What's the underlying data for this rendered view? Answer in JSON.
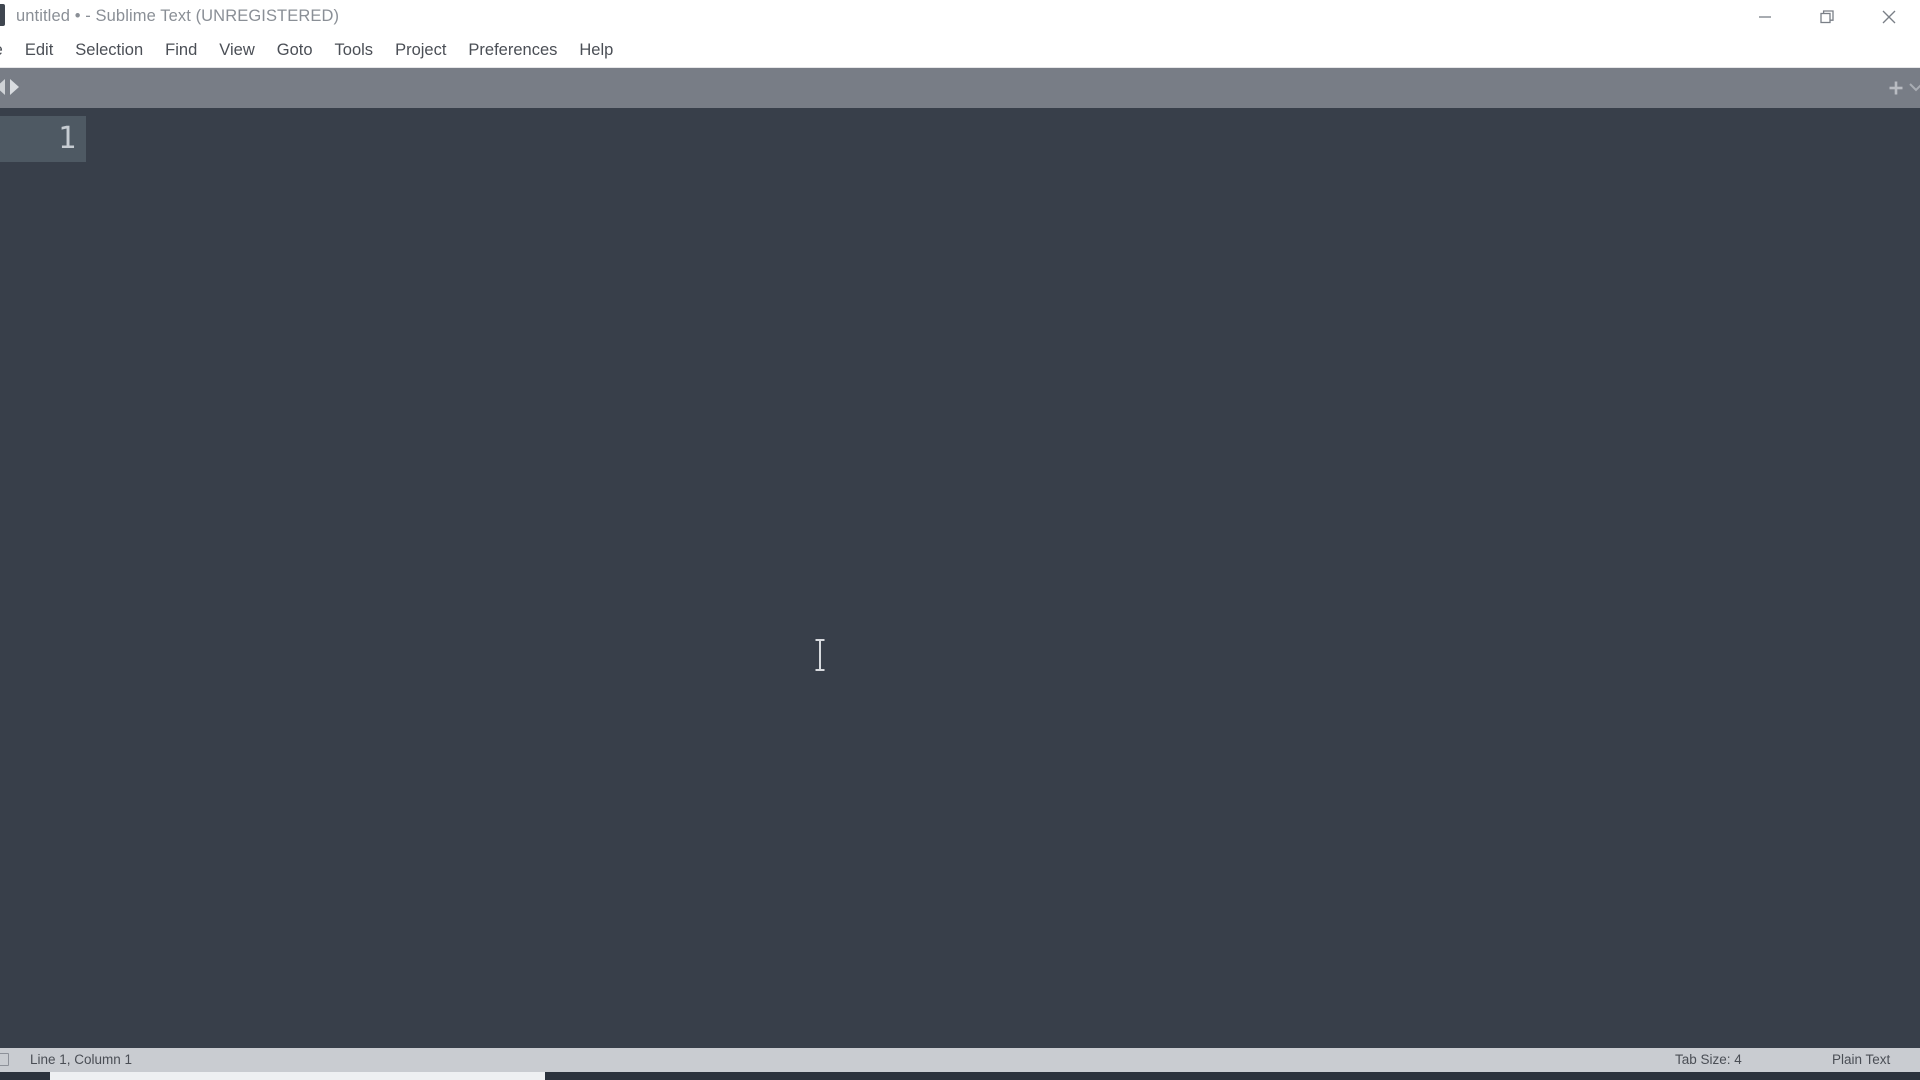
{
  "window": {
    "title": "untitled • - Sublime Text (UNREGISTERED)",
    "app_icon": "sublime-text-icon",
    "controls": {
      "minimize": "minimize-icon",
      "restore": "restore-icon",
      "close": "close-icon"
    }
  },
  "menubar": {
    "items": [
      {
        "label": "le",
        "name": "menu-file",
        "clipped": true
      },
      {
        "label": "Edit",
        "name": "menu-edit",
        "clipped": false
      },
      {
        "label": "Selection",
        "name": "menu-selection",
        "clipped": false
      },
      {
        "label": "Find",
        "name": "menu-find",
        "clipped": false
      },
      {
        "label": "View",
        "name": "menu-view",
        "clipped": false
      },
      {
        "label": "Goto",
        "name": "menu-goto",
        "clipped": false
      },
      {
        "label": "Tools",
        "name": "menu-tools",
        "clipped": false
      },
      {
        "label": "Project",
        "name": "menu-project",
        "clipped": false
      },
      {
        "label": "Preferences",
        "name": "menu-preferences",
        "clipped": false
      },
      {
        "label": "Help",
        "name": "menu-help",
        "clipped": false
      }
    ]
  },
  "tabbar": {
    "scroll_left_icon": "arrow-left-icon",
    "scroll_right_icon": "arrow-right-icon",
    "new_tab_icon": "plus-icon",
    "tabs": []
  },
  "editor": {
    "line_numbers": [
      "1"
    ],
    "content": "",
    "active_line": "1"
  },
  "statusbar": {
    "sidebar_toggle_icon": "sidebar-toggle-icon",
    "line_column": "Line 1, Column 1",
    "tab_size": "Tab Size: 4",
    "syntax": "Plain Text"
  },
  "colors": {
    "titlebar_bg": "#ffffff",
    "menubar_bg": "#ffffff",
    "tabbar_bg": "#787d86",
    "editor_bg": "#383f4a",
    "gutter_active_bg": "#4e5963",
    "statusbar_bg": "#c9ccd1",
    "scrollbar_track": "#2b323c",
    "scrollbar_thumb": "#eef0f2"
  }
}
